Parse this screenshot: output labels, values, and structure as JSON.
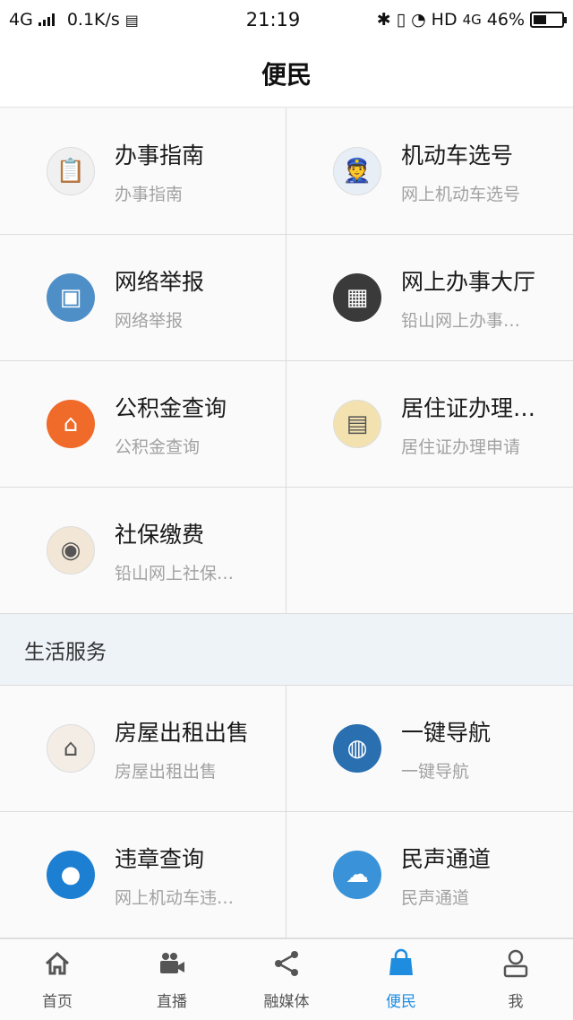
{
  "status_bar": {
    "network": "4G",
    "speed": "0.1K/s",
    "time": "21:19",
    "hd": "HD",
    "network2": "4G",
    "battery": "46%"
  },
  "header": {
    "title": "便民"
  },
  "services": [
    {
      "title": "办事指南",
      "subtitle": "办事指南",
      "icon": "clipboard-icon",
      "color": "#f0f0f0"
    },
    {
      "title": "机动车选号",
      "subtitle": "网上机动车选号",
      "icon": "police-officer-icon",
      "color": "#e8eef6"
    },
    {
      "title": "网络举报",
      "subtitle": "网络举报",
      "icon": "report-icon",
      "color": "#4f8fc8"
    },
    {
      "title": "网上办事大厅",
      "subtitle": "铅山网上办事…",
      "icon": "hall-icon",
      "color": "#3a3a3a"
    },
    {
      "title": "公积金查询",
      "subtitle": "公积金查询",
      "icon": "house-fund-icon",
      "color": "#f06a2a"
    },
    {
      "title": "居住证办理…",
      "subtitle": "居住证办理申请",
      "icon": "residence-permit-icon",
      "color": "#f3e2b0"
    },
    {
      "title": "社保缴费",
      "subtitle": "铅山网上社保…",
      "icon": "social-security-icon",
      "color": "#f2e6d6"
    }
  ],
  "life_section": {
    "title": "生活服务",
    "items": [
      {
        "title": "房屋出租出售",
        "subtitle": "房屋出租出售",
        "icon": "house-rent-icon",
        "color": "#f3ede6"
      },
      {
        "title": "一键导航",
        "subtitle": "一键导航",
        "icon": "satellite-globe-icon",
        "color": "#2a6fb0"
      },
      {
        "title": "违章查询",
        "subtitle": "网上机动车违…",
        "icon": "violation-query-icon",
        "color": "#1c7fd1"
      },
      {
        "title": "民声通道",
        "subtitle": "民声通道",
        "icon": "cloud-channel-icon",
        "color": "#3a93d8"
      }
    ]
  },
  "tabs": [
    {
      "label": "首页",
      "icon": "home-icon"
    },
    {
      "label": "直播",
      "icon": "video-camera-icon"
    },
    {
      "label": "融媒体",
      "icon": "share-icon"
    },
    {
      "label": "便民",
      "icon": "shopping-bag-icon",
      "active": true
    },
    {
      "label": "我",
      "icon": "user-icon"
    }
  ],
  "colors": {
    "accent": "#1e8de0"
  }
}
